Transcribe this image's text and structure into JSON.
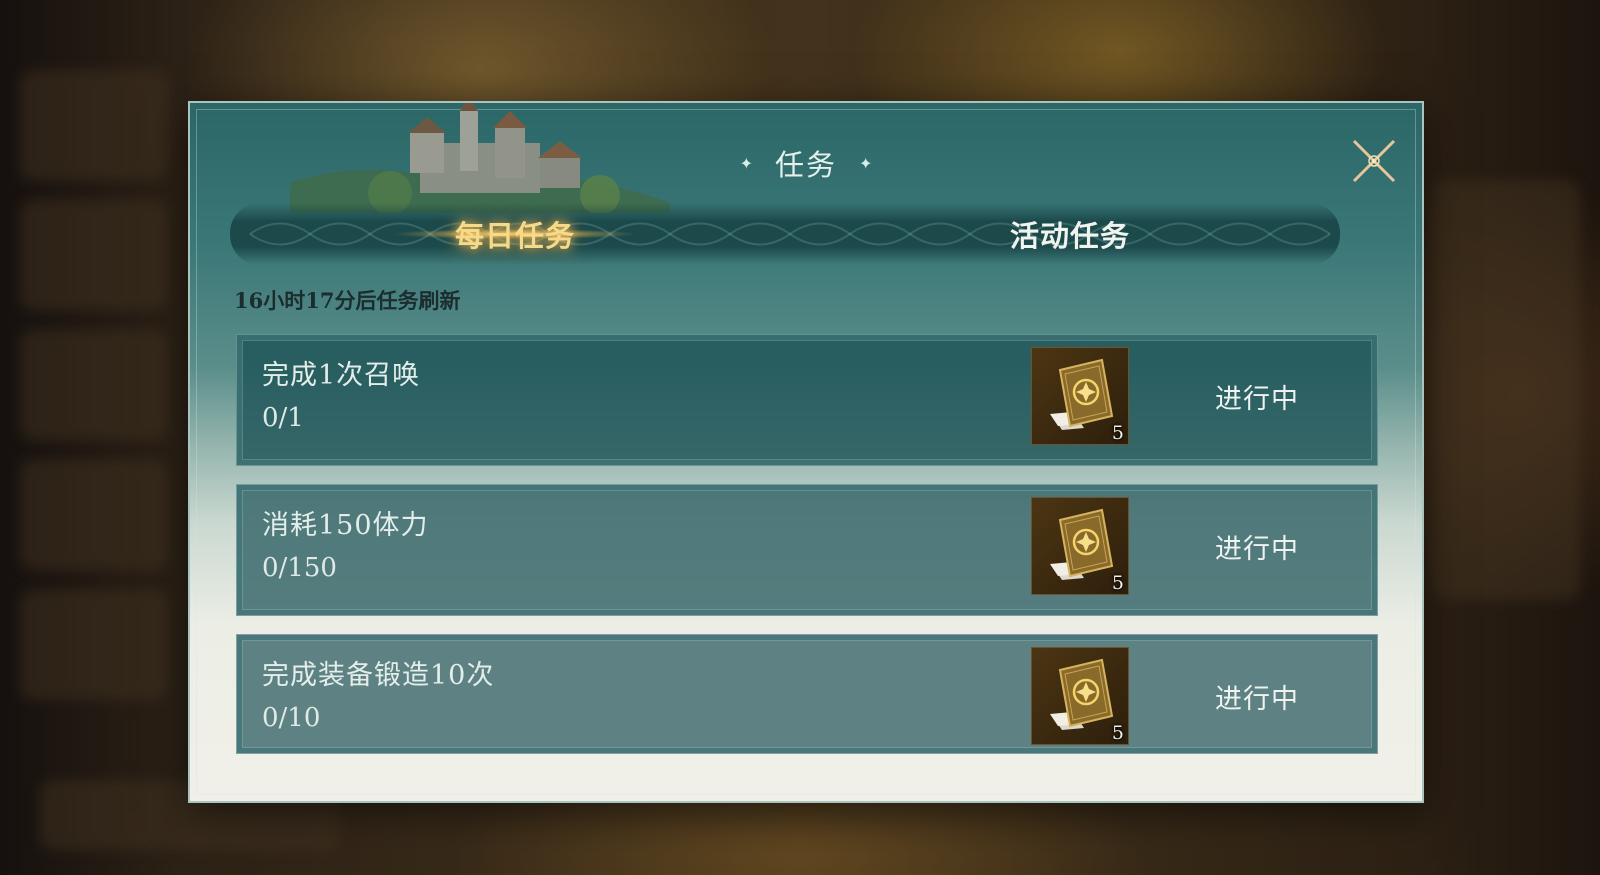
{
  "dialog": {
    "title": "任务"
  },
  "tabs": [
    {
      "label": "每日任务",
      "active": true
    },
    {
      "label": "活动任务",
      "active": false
    }
  ],
  "refresh_text": "16小时17分后任务刷新",
  "tasks": [
    {
      "name": "完成1次召唤",
      "progress": "0/1",
      "reward_icon": "summon-card-icon",
      "reward_count": "5",
      "status": "进行中"
    },
    {
      "name": "消耗150体力",
      "progress": "0/150",
      "reward_icon": "summon-card-icon",
      "reward_count": "5",
      "status": "进行中"
    },
    {
      "name": "完成装备锻造10次",
      "progress": "0/10",
      "reward_icon": "summon-card-icon",
      "reward_count": "5",
      "status": "进行中"
    }
  ],
  "colors": {
    "active_tab": "#f6d98a",
    "panel_teal": "#2c6768",
    "close_x": "#e6c79a"
  }
}
